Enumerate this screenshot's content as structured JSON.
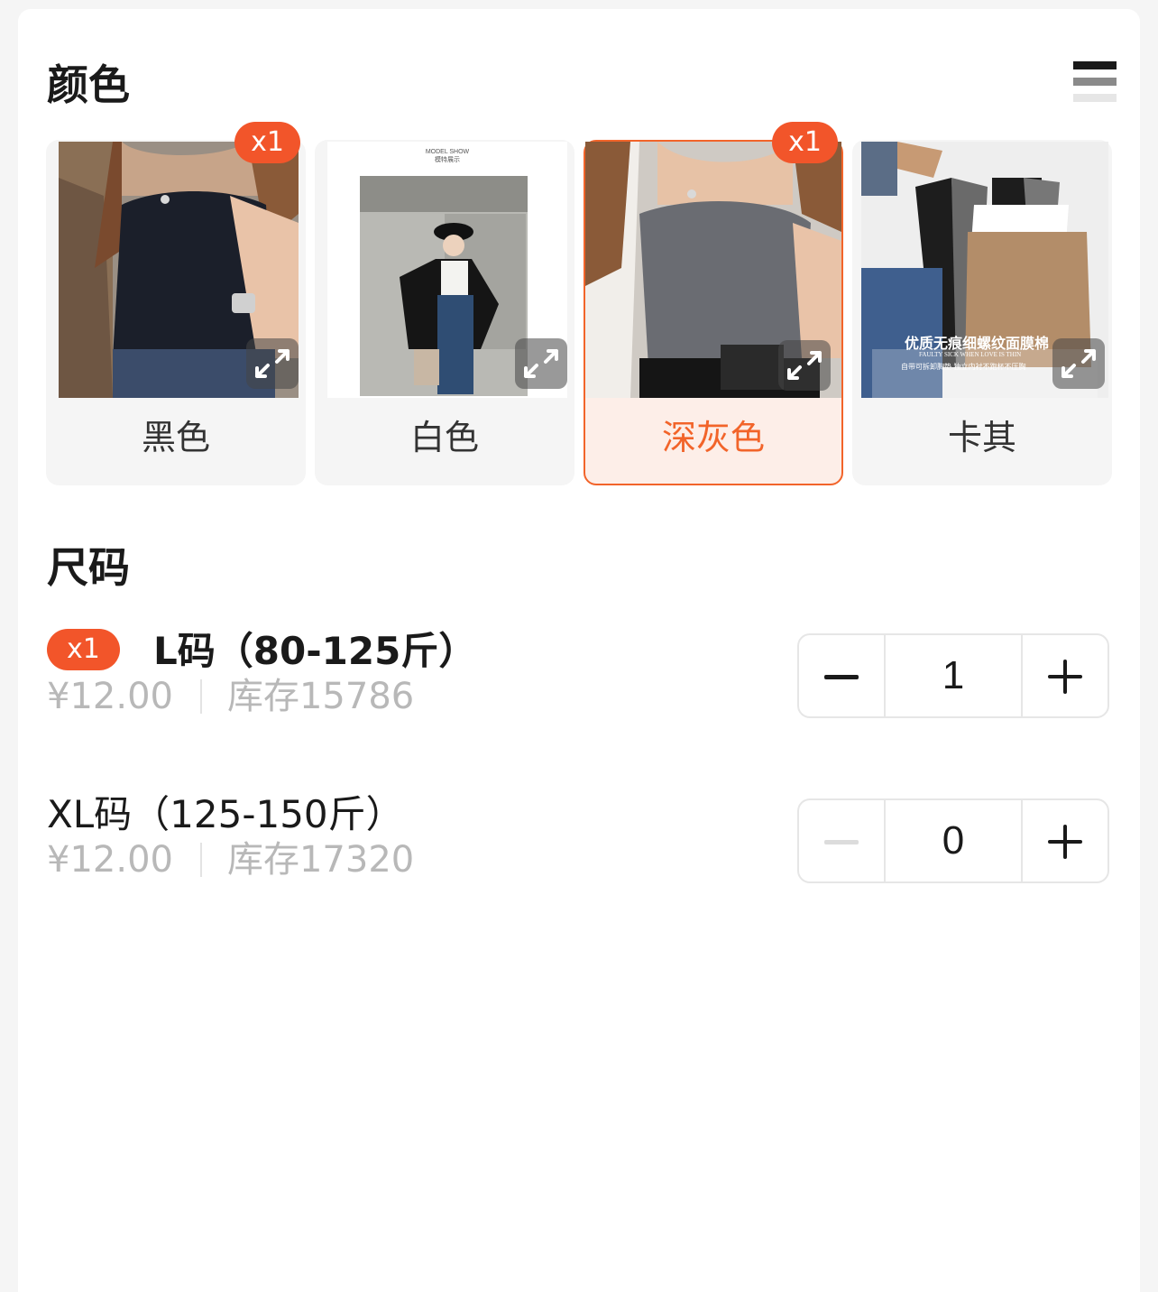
{
  "colors": {
    "title": "颜色",
    "accent": "#f2642a",
    "items": [
      {
        "label": "黑色",
        "badge": "x1",
        "selected": false
      },
      {
        "label": "白色",
        "badge": "",
        "selected": false,
        "image_caption_title": "MODEL SHOW",
        "image_caption_sub": "模特展示"
      },
      {
        "label": "深灰色",
        "badge": "x1",
        "selected": true
      },
      {
        "label": "卡其",
        "badge": "",
        "selected": false,
        "image_text_main": "优质无痕细螺纹面膜棉",
        "image_text_sub": "FAULTY SICK WHEN LOVE IS THIN",
        "image_text_sub2": "自带可拆卸胸垫 独立内衬不跑杯不压胸"
      }
    ]
  },
  "sizes": {
    "title": "尺码",
    "items": [
      {
        "badge": "x1",
        "name": "L码（80-125斤）",
        "price": "¥12.00",
        "stock": "库存15786",
        "quantity": "1"
      },
      {
        "badge": "",
        "name": "XL码（125-150斤）",
        "price": "¥12.00",
        "stock": "库存17320",
        "quantity": "0"
      }
    ]
  }
}
